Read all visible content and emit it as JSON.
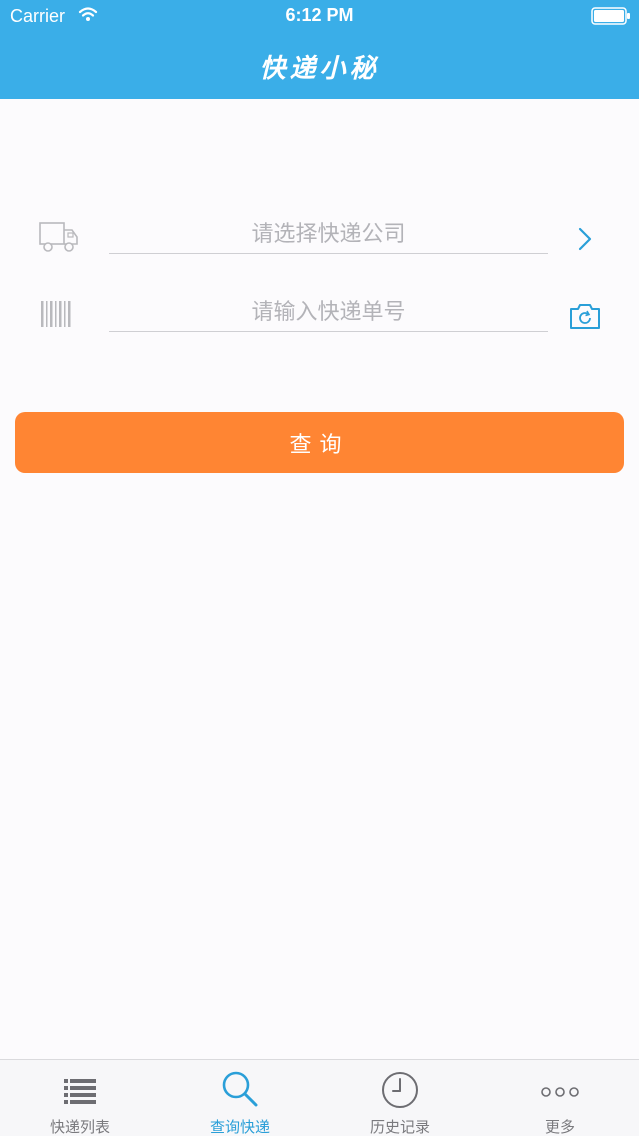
{
  "status_bar": {
    "carrier": "Carrier",
    "time": "6:12 PM"
  },
  "nav": {
    "title": "快递小秘"
  },
  "form": {
    "company_placeholder": "请选择快递公司",
    "number_placeholder": "请输入快递单号",
    "company_icon": "truck-icon",
    "number_icon": "barcode-icon",
    "chevron_icon": "chevron-right-icon",
    "camera_icon": "camera-icon"
  },
  "query_button": {
    "label": "查询"
  },
  "tabs": [
    {
      "label": "快递列表",
      "icon": "list-icon",
      "active": false
    },
    {
      "label": "查询快递",
      "icon": "search-icon",
      "active": true
    },
    {
      "label": "历史记录",
      "icon": "clock-icon",
      "active": false
    },
    {
      "label": "更多",
      "icon": "more-icon",
      "active": false
    }
  ],
  "colors": {
    "header": "#3aaee8",
    "accent": "#2a9fd8",
    "button": "#ff8533",
    "background": "#fcfbfd"
  }
}
